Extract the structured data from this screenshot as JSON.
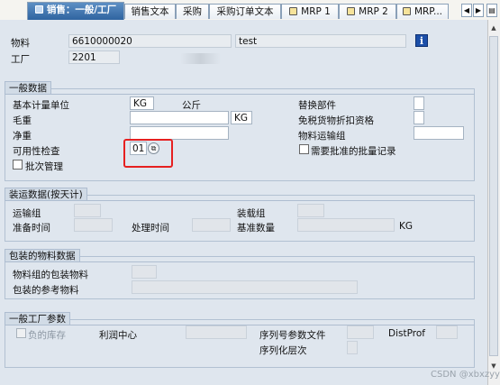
{
  "tabs": [
    {
      "label": "销售：一般/工厂",
      "active": true
    },
    {
      "label": "销售文本"
    },
    {
      "label": "采购"
    },
    {
      "label": "采购订单文本"
    },
    {
      "label": "MRP 1"
    },
    {
      "label": "MRP 2"
    },
    {
      "label": "MRP..."
    }
  ],
  "header": {
    "material_label": "物料",
    "material_value": "6610000020",
    "material_desc": "test",
    "plant_label": "工厂",
    "plant_value": "2201"
  },
  "general": {
    "title": "一般数据",
    "base_uom_label": "基本计量单位",
    "base_uom_value": "KG",
    "base_uom_text": "公斤",
    "replacement_part_label": "替换部件",
    "gross_weight_label": "毛重",
    "gross_weight_unit": "KG",
    "duty_free_label": "免税货物折扣资格",
    "net_weight_label": "净重",
    "transport_group_label": "物料运输组",
    "availability_label": "可用性检查",
    "availability_value": "01",
    "approved_batch_label": "需要批准的批量记录",
    "batch_mgmt_label": "批次管理"
  },
  "shipping": {
    "title": "装运数据(按天计)",
    "trans_group_label": "运输组",
    "loading_group_label": "装载组",
    "setup_time_label": "准备时间",
    "proc_time_label": "处理时间",
    "base_qty_label": "基准数量",
    "base_qty_unit": "KG"
  },
  "packaging": {
    "title": "包装的物料数据",
    "mat_group_label": "物料组的包装物料",
    "ref_mat_label": "包装的参考物料"
  },
  "plant_params": {
    "title": "一般工厂参数",
    "neg_stock_label": "负的库存",
    "profit_center_label": "利润中心",
    "serial_profile_label": "序列号参数文件",
    "distprof_label": "DistProf",
    "serial_level_label": "序列化层次"
  },
  "watermark": "CSDN @xbxzyy",
  "colors": {
    "highlight": "#e62020",
    "active_tab": "#3a6ea8"
  }
}
